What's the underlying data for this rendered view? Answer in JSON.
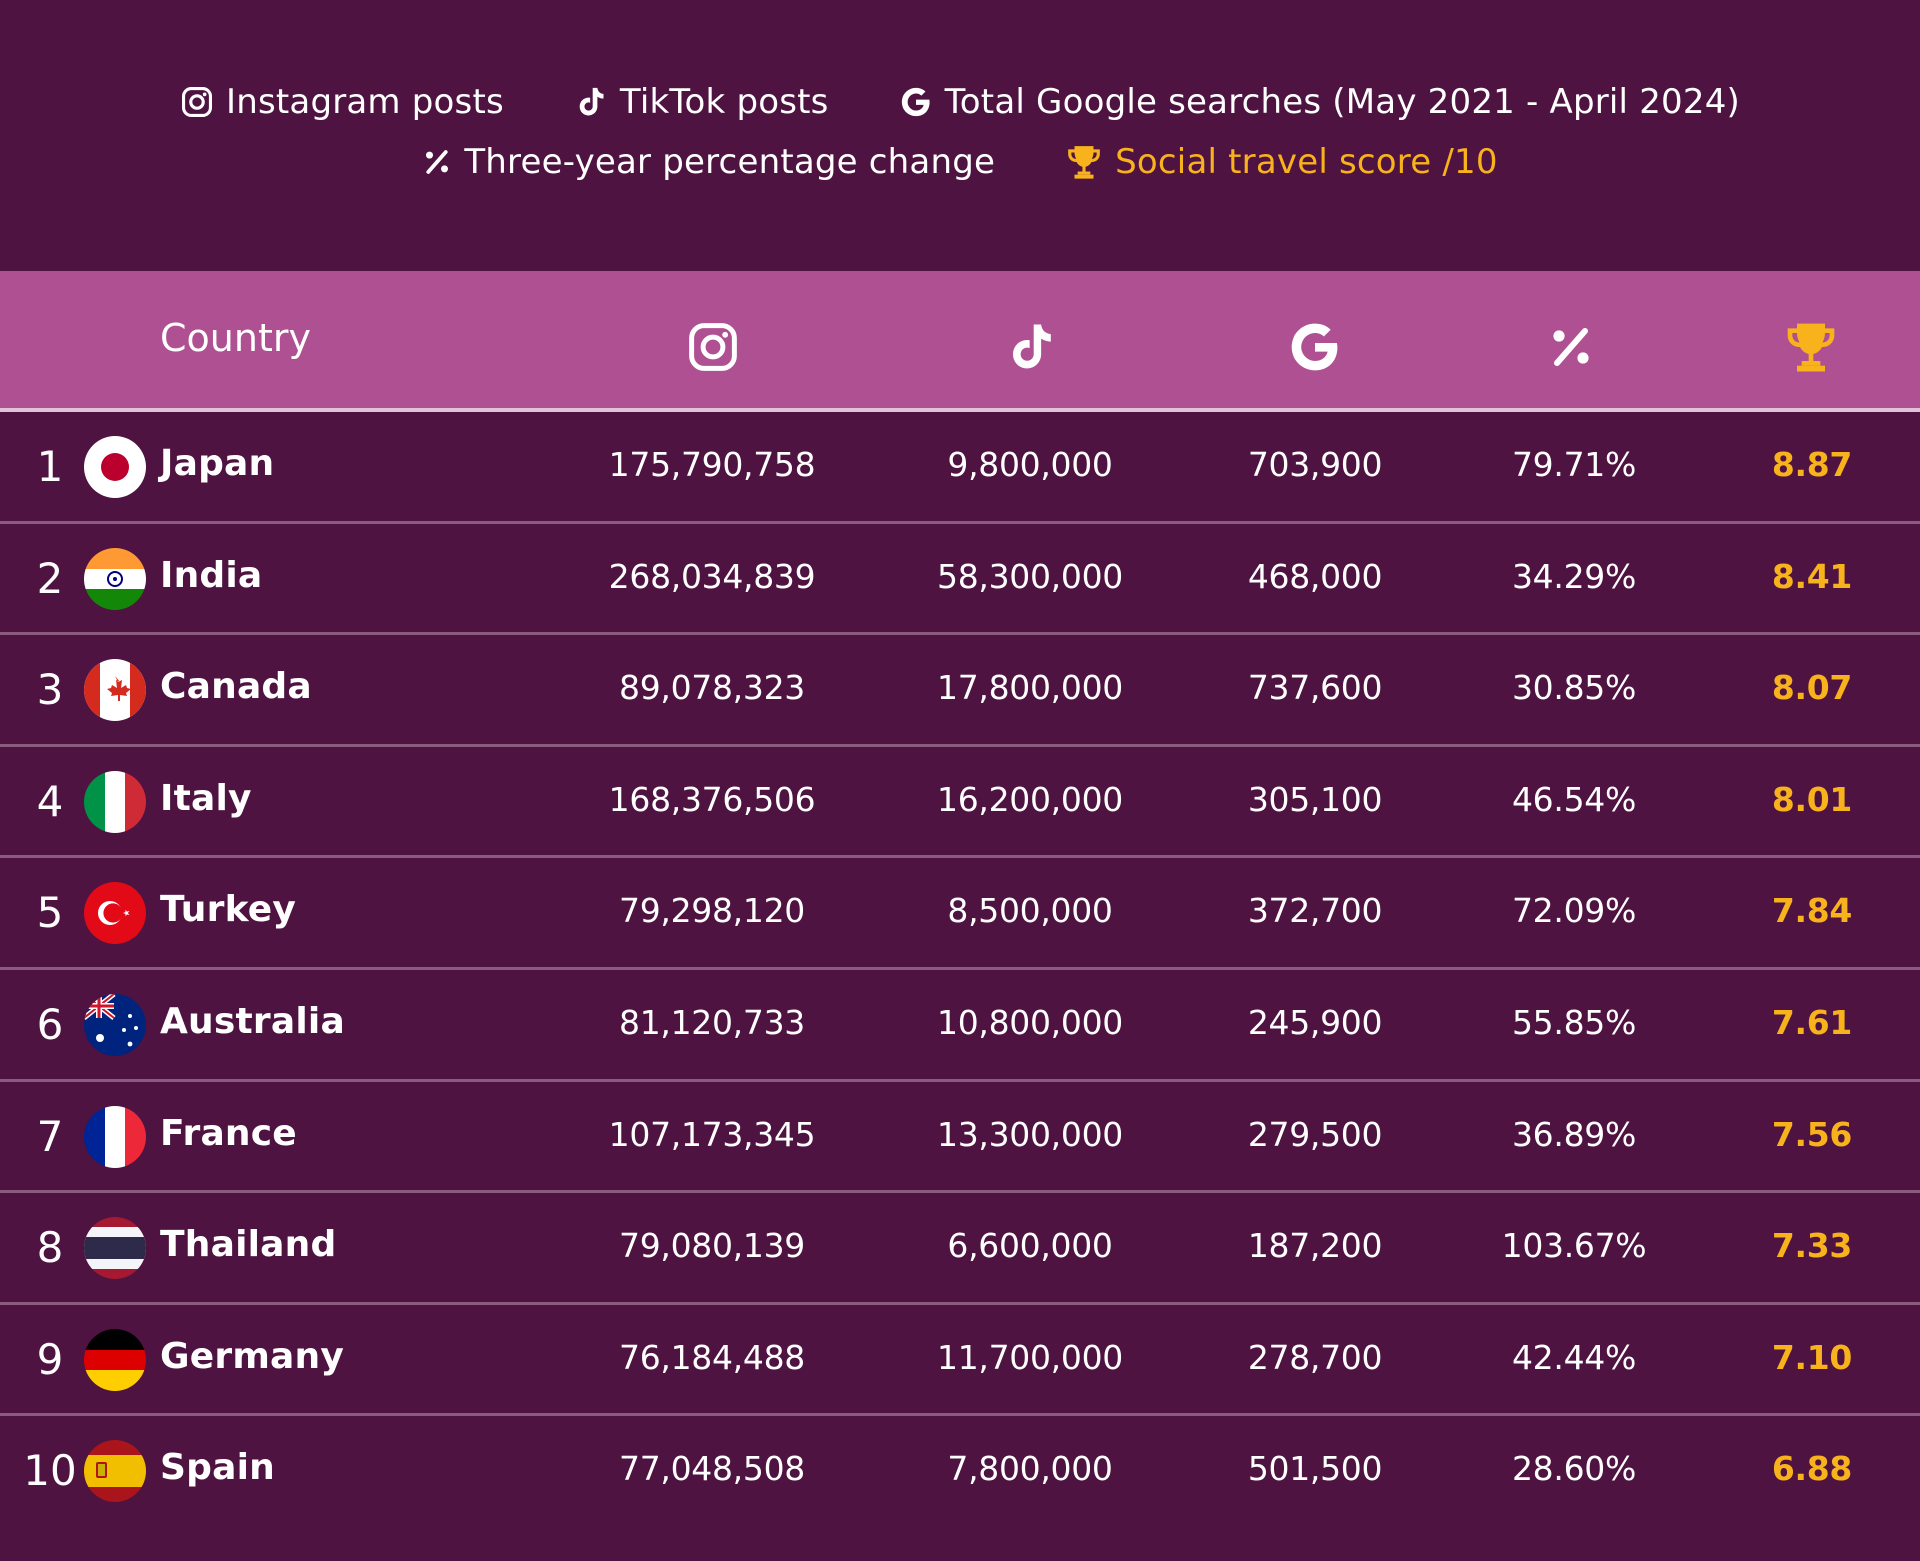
{
  "legend": {
    "instagram": {
      "label": "Instagram posts",
      "icon": "instagram-icon"
    },
    "tiktok": {
      "label": "TikTok posts",
      "icon": "tiktok-icon"
    },
    "google": {
      "label": "Total Google searches (May 2021 - April 2024)",
      "icon": "google-icon"
    },
    "change": {
      "label": "Three-year percentage change",
      "icon": "percent-icon"
    },
    "score": {
      "label": "Social travel score /10",
      "icon": "trophy-icon"
    }
  },
  "colors": {
    "background": "#4e1340",
    "header": "#af5093",
    "accent_gold": "#f7b21c",
    "divider": "#8a5a7f"
  },
  "chart_data": {
    "type": "table",
    "columns": [
      "Country",
      "Instagram posts",
      "TikTok posts",
      "Total Google searches (May 2021 - April 2024)",
      "Three-year percentage change",
      "Social travel score /10"
    ],
    "header": {
      "country": "Country"
    },
    "rows": [
      {
        "rank": "1",
        "country": "Japan",
        "flag": "japan-flag",
        "instagram": "175,790,758",
        "tiktok": "9,800,000",
        "google": "703,900",
        "change": "79.71%",
        "score": "8.87"
      },
      {
        "rank": "2",
        "country": "India",
        "flag": "india-flag",
        "instagram": "268,034,839",
        "tiktok": "58,300,000",
        "google": "468,000",
        "change": "34.29%",
        "score": "8.41"
      },
      {
        "rank": "3",
        "country": "Canada",
        "flag": "canada-flag",
        "instagram": "89,078,323",
        "tiktok": "17,800,000",
        "google": "737,600",
        "change": "30.85%",
        "score": "8.07"
      },
      {
        "rank": "4",
        "country": "Italy",
        "flag": "italy-flag",
        "instagram": "168,376,506",
        "tiktok": "16,200,000",
        "google": "305,100",
        "change": "46.54%",
        "score": "8.01"
      },
      {
        "rank": "5",
        "country": "Turkey",
        "flag": "turkey-flag",
        "instagram": "79,298,120",
        "tiktok": "8,500,000",
        "google": "372,700",
        "change": "72.09%",
        "score": "7.84"
      },
      {
        "rank": "6",
        "country": "Australia",
        "flag": "australia-flag",
        "instagram": "81,120,733",
        "tiktok": "10,800,000",
        "google": "245,900",
        "change": "55.85%",
        "score": "7.61"
      },
      {
        "rank": "7",
        "country": "France",
        "flag": "france-flag",
        "instagram": "107,173,345",
        "tiktok": "13,300,000",
        "google": "279,500",
        "change": "36.89%",
        "score": "7.56"
      },
      {
        "rank": "8",
        "country": "Thailand",
        "flag": "thailand-flag",
        "instagram": "79,080,139",
        "tiktok": "6,600,000",
        "google": "187,200",
        "change": "103.67%",
        "score": "7.33"
      },
      {
        "rank": "9",
        "country": "Germany",
        "flag": "germany-flag",
        "instagram": "76,184,488",
        "tiktok": "11,700,000",
        "google": "278,700",
        "change": "42.44%",
        "score": "7.10"
      },
      {
        "rank": "10",
        "country": "Spain",
        "flag": "spain-flag",
        "instagram": "77,048,508",
        "tiktok": "7,800,000",
        "google": "501,500",
        "change": "28.60%",
        "score": "6.88"
      }
    ]
  }
}
